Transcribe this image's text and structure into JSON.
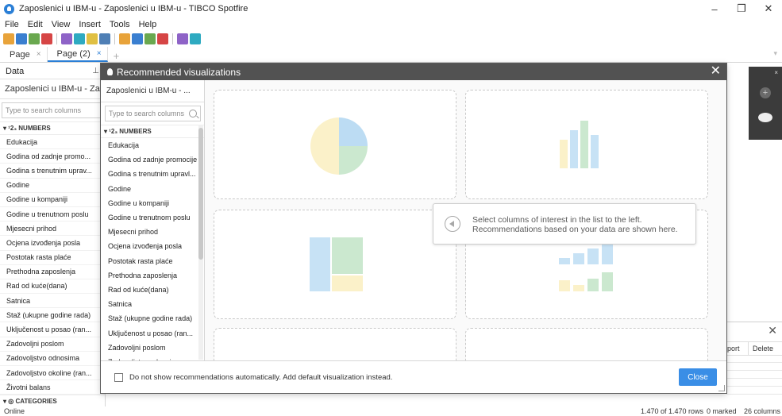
{
  "window": {
    "title": "Zaposlenici u IBM-u - Zaposlenici u IBM-u - TIBCO Spotfire",
    "minimize": "–",
    "maximize": "❐",
    "close": "✕"
  },
  "menu": [
    "File",
    "Edit",
    "View",
    "Insert",
    "Tools",
    "Help"
  ],
  "toolbar": {
    "icons": [
      "open-icon",
      "save-icon",
      "undo-icon",
      "redo-icon",
      "filter-icon",
      "table-icon",
      "bar-chart-icon",
      "line-chart-icon",
      "pie-chart-icon",
      "scatter-icon",
      "map-icon",
      "treemap-icon",
      "heatmap-icon",
      "text-area-icon"
    ],
    "colors": [
      "#e8a33a",
      "#3a7fd0",
      "#6aa84f",
      "#d64545",
      "#8e63c7",
      "#2eaac1",
      "#e0c043",
      "#4f7fb5"
    ]
  },
  "page_tabs": {
    "tabs": [
      {
        "label": "Page",
        "close": "×"
      },
      {
        "label": "Page (2)",
        "close": "×"
      }
    ],
    "add": "+"
  },
  "data_panel": {
    "title": "Data",
    "pin": "📌",
    "source": "Zaposlenici u IBM-u - Zap...",
    "search_placeholder": "Type to search columns",
    "group_numbers": "▾ ¹2₃ NUMBERS",
    "items": [
      "Edukacija",
      "Godina od zadnje promo...",
      "Godina s trenutnim uprav...",
      "Godine",
      "Godine u kompaniji",
      "Godine u trenutnom poslu",
      "Mjesecni prihod",
      "Ocjena izvođenja posla",
      "Postotak rasta plaće",
      "Prethodna zaposlenja",
      "Rad od kuće(dana)",
      "Satnica",
      "Staž (ukupne godine rada)",
      "Uključenost u posao (ran...",
      "Zadovoljni poslom",
      "Zadovoljstvo odnosima",
      "Zadovoljstvo okoline (ran...",
      "Životni balans"
    ],
    "group_categories": "▾ ◎ CATEGORIES"
  },
  "modal": {
    "title": "Recommended visualizations",
    "close": "✕",
    "source": "Zaposlenici u IBM-u - ...",
    "search_placeholder": "Type to search columns",
    "group_numbers": "▾ ¹2₃ NUMBERS",
    "items": [
      "Edukacija",
      "Godina od zadnje promocije",
      "Godina s trenutnim upravl...",
      "Godine",
      "Godine u kompaniji",
      "Godine u trenutnom poslu",
      "Mjesecni prihod",
      "Ocjena izvođenja posla",
      "Postotak rasta plaće",
      "Prethodna zaposlenja",
      "Rad od kuće(dana)",
      "Satnica",
      "Staž (ukupne godine rada)",
      "Uključenost u posao (ran...",
      "Zadovoljni poslom",
      "Zadovoljstvo odnosima"
    ],
    "hint_line1": "Select columns of interest in the list to the left.",
    "hint_line2": "Recommendations based on your data are shown here.",
    "footer_text": "Do not show recommendations automatically. Add default visualization instead.",
    "close_button": "Close",
    "card_colors": {
      "pie_blue": "#bcdcf3",
      "pie_yellow": "#fbf1c9",
      "pie_green": "#cbe8cf",
      "bar_blue": "#c7e2f5",
      "bar_green": "#cbe8cf",
      "bar_yellow": "#fbf1c9"
    }
  },
  "right_panel": {
    "close": "×",
    "plus": "+",
    "table_close": "✕",
    "col_partial": "port",
    "col_delete": "Delete"
  },
  "status": {
    "left": "Online",
    "rows": "1.470 of 1.470 rows",
    "marked": "0 marked",
    "columns": "26 columns"
  }
}
